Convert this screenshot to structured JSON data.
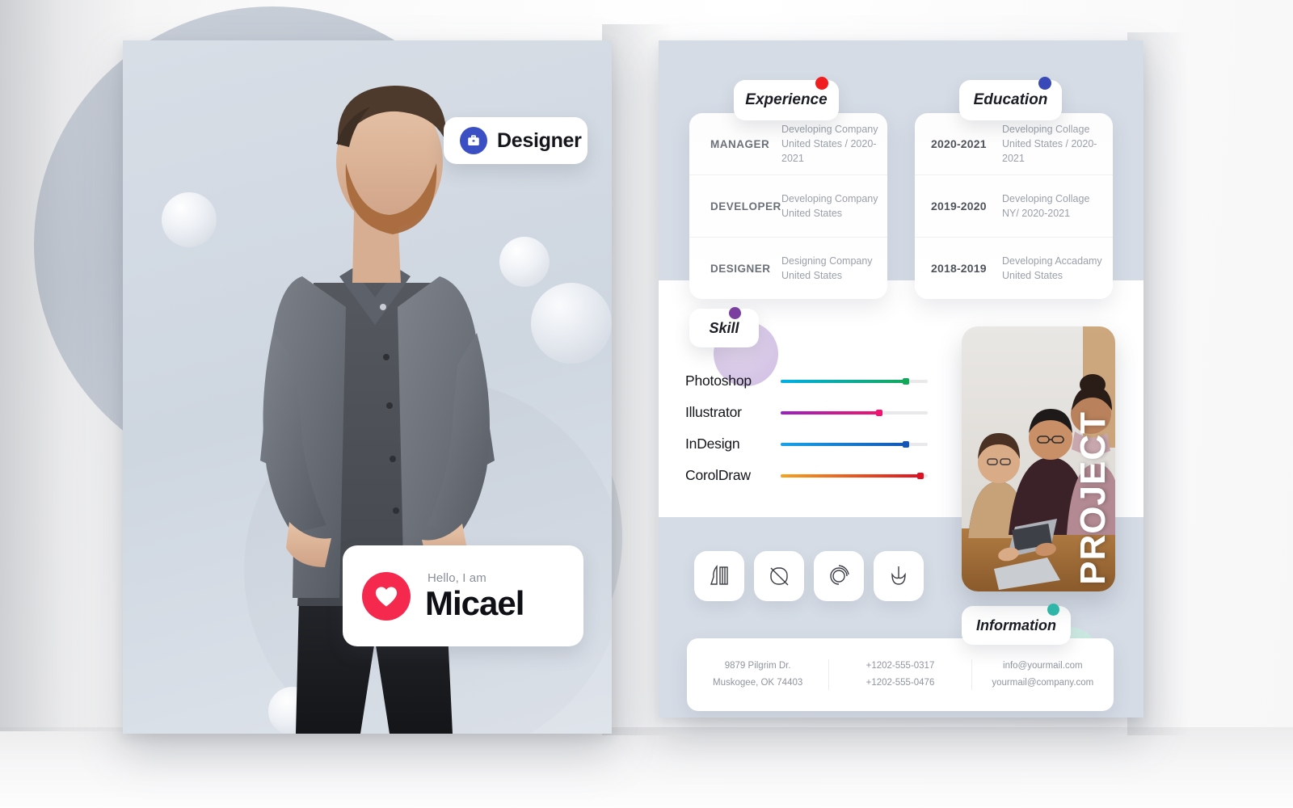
{
  "meta": {
    "doc_type": "resume-cv-template-mockup",
    "poster_left_name": "cover-page",
    "poster_right_name": "content-page"
  },
  "cover": {
    "role_badge": {
      "label": "Designer",
      "icon": "briefcase-icon",
      "accent": "#3b4fc4"
    },
    "name_card": {
      "greeting": "Hello, I am",
      "name": "Micael",
      "icon": "heart-icon",
      "accent": "#f5284e"
    }
  },
  "experience": {
    "title": "Experience",
    "dot_color": "#f01e1e",
    "rows": [
      {
        "role": "MANAGER",
        "line1": "Developing Company",
        "line2": "United States / 2020-2021"
      },
      {
        "role": "DEVELOPER",
        "line1": "Developing Company",
        "line2": "United States"
      },
      {
        "role": "DESIGNER",
        "line1": "Designing Company",
        "line2": "United States"
      }
    ]
  },
  "education": {
    "title": "Education",
    "dot_color": "#3a49b8",
    "rows": [
      {
        "years": "2020-2021",
        "line1": "Developing Collage",
        "line2": "United States / 2020-2021"
      },
      {
        "years": "2019-2020",
        "line1": "Developing Collage",
        "line2": "NY/ 2020-2021"
      },
      {
        "years": "2018-2019",
        "line1": "Developing Accadamy",
        "line2": "United States"
      }
    ]
  },
  "skill": {
    "title": "Skill",
    "dot_color": "#7b3fa0",
    "items": [
      {
        "name": "Photoshop",
        "percent": 85,
        "from": "#00aee6",
        "to": "#12a85a"
      },
      {
        "name": "Illustrator",
        "percent": 67,
        "from": "#9b1fc1",
        "to": "#f0136f"
      },
      {
        "name": "InDesign",
        "percent": 85,
        "from": "#17a2e8",
        "to": "#1456b8"
      },
      {
        "name": "CorolDraw",
        "percent": 95,
        "from": "#f5a31b",
        "to": "#e01020"
      }
    ]
  },
  "project": {
    "word": "PROJECT",
    "photo_alt": "three-colleagues-around-laptop"
  },
  "icon_row": [
    {
      "name": "abstract-ribbon-icon"
    },
    {
      "name": "abstract-no-entry-icon"
    },
    {
      "name": "abstract-spiral-icon"
    },
    {
      "name": "abstract-tulip-icon"
    }
  ],
  "information": {
    "title": "Information",
    "dot_color": "#2fb6a8",
    "columns": [
      {
        "line1": "9879 Pilgrim Dr.",
        "line2": "Muskogee, OK 74403"
      },
      {
        "line1": "+1202-555-0317",
        "line2": "+1202-555-0476"
      },
      {
        "line1": "info@yourmail.com",
        "line2": "yourmail@company.com"
      }
    ]
  }
}
